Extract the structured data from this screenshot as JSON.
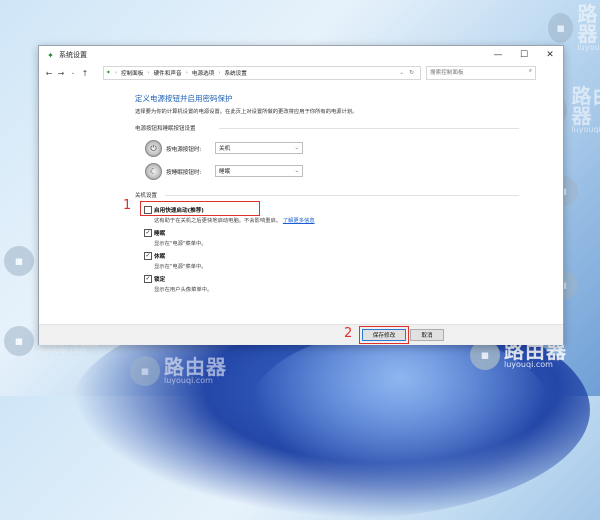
{
  "window": {
    "title": "系统设置",
    "controls": {
      "minimize": "—",
      "maximize": "☐",
      "close": "✕"
    }
  },
  "addressbar": {
    "breadcrumb": [
      "控制面板",
      "硬件和声音",
      "电源选项",
      "系统设置"
    ],
    "search_placeholder": "搜索控制面板"
  },
  "page": {
    "title": "定义电源按钮并启用密码保护",
    "description": "选择要为你的计算机设置的电源设置。在此页上对设置所做的更改将应用于你所有的电源计划。",
    "section_buttons": "电源按钮和睡眠按钮设置",
    "power_button": {
      "label": "按电源按钮时:",
      "value": "关机"
    },
    "sleep_button": {
      "label": "按睡眠按钮时:",
      "value": "睡眠"
    },
    "section_shutdown": "关机设置",
    "fast_startup": {
      "label": "启用快速启动(推荐)",
      "checked": false,
      "desc": "这有助于在关机之后更快地启动电脑。不会影响重启。",
      "link": "了解更多信息"
    },
    "sleep": {
      "label": "睡眠",
      "checked": true,
      "desc": "显示在\"电源\"菜单中。"
    },
    "hibernate": {
      "label": "休眠",
      "checked": true,
      "desc": "显示在\"电源\"菜单中。"
    },
    "lock": {
      "label": "锁定",
      "checked": true,
      "desc": "显示在用户头像菜单中。"
    }
  },
  "footer": {
    "save": "保存修改",
    "cancel": "取消"
  },
  "annotations": {
    "step1": "1",
    "step2": "2"
  },
  "watermark": {
    "brand": "路由器",
    "domain": "luyouqi.com"
  },
  "colors": {
    "accent": "#1b5fb1",
    "annotation": "#e0302c",
    "link": "#1a5fcf"
  }
}
